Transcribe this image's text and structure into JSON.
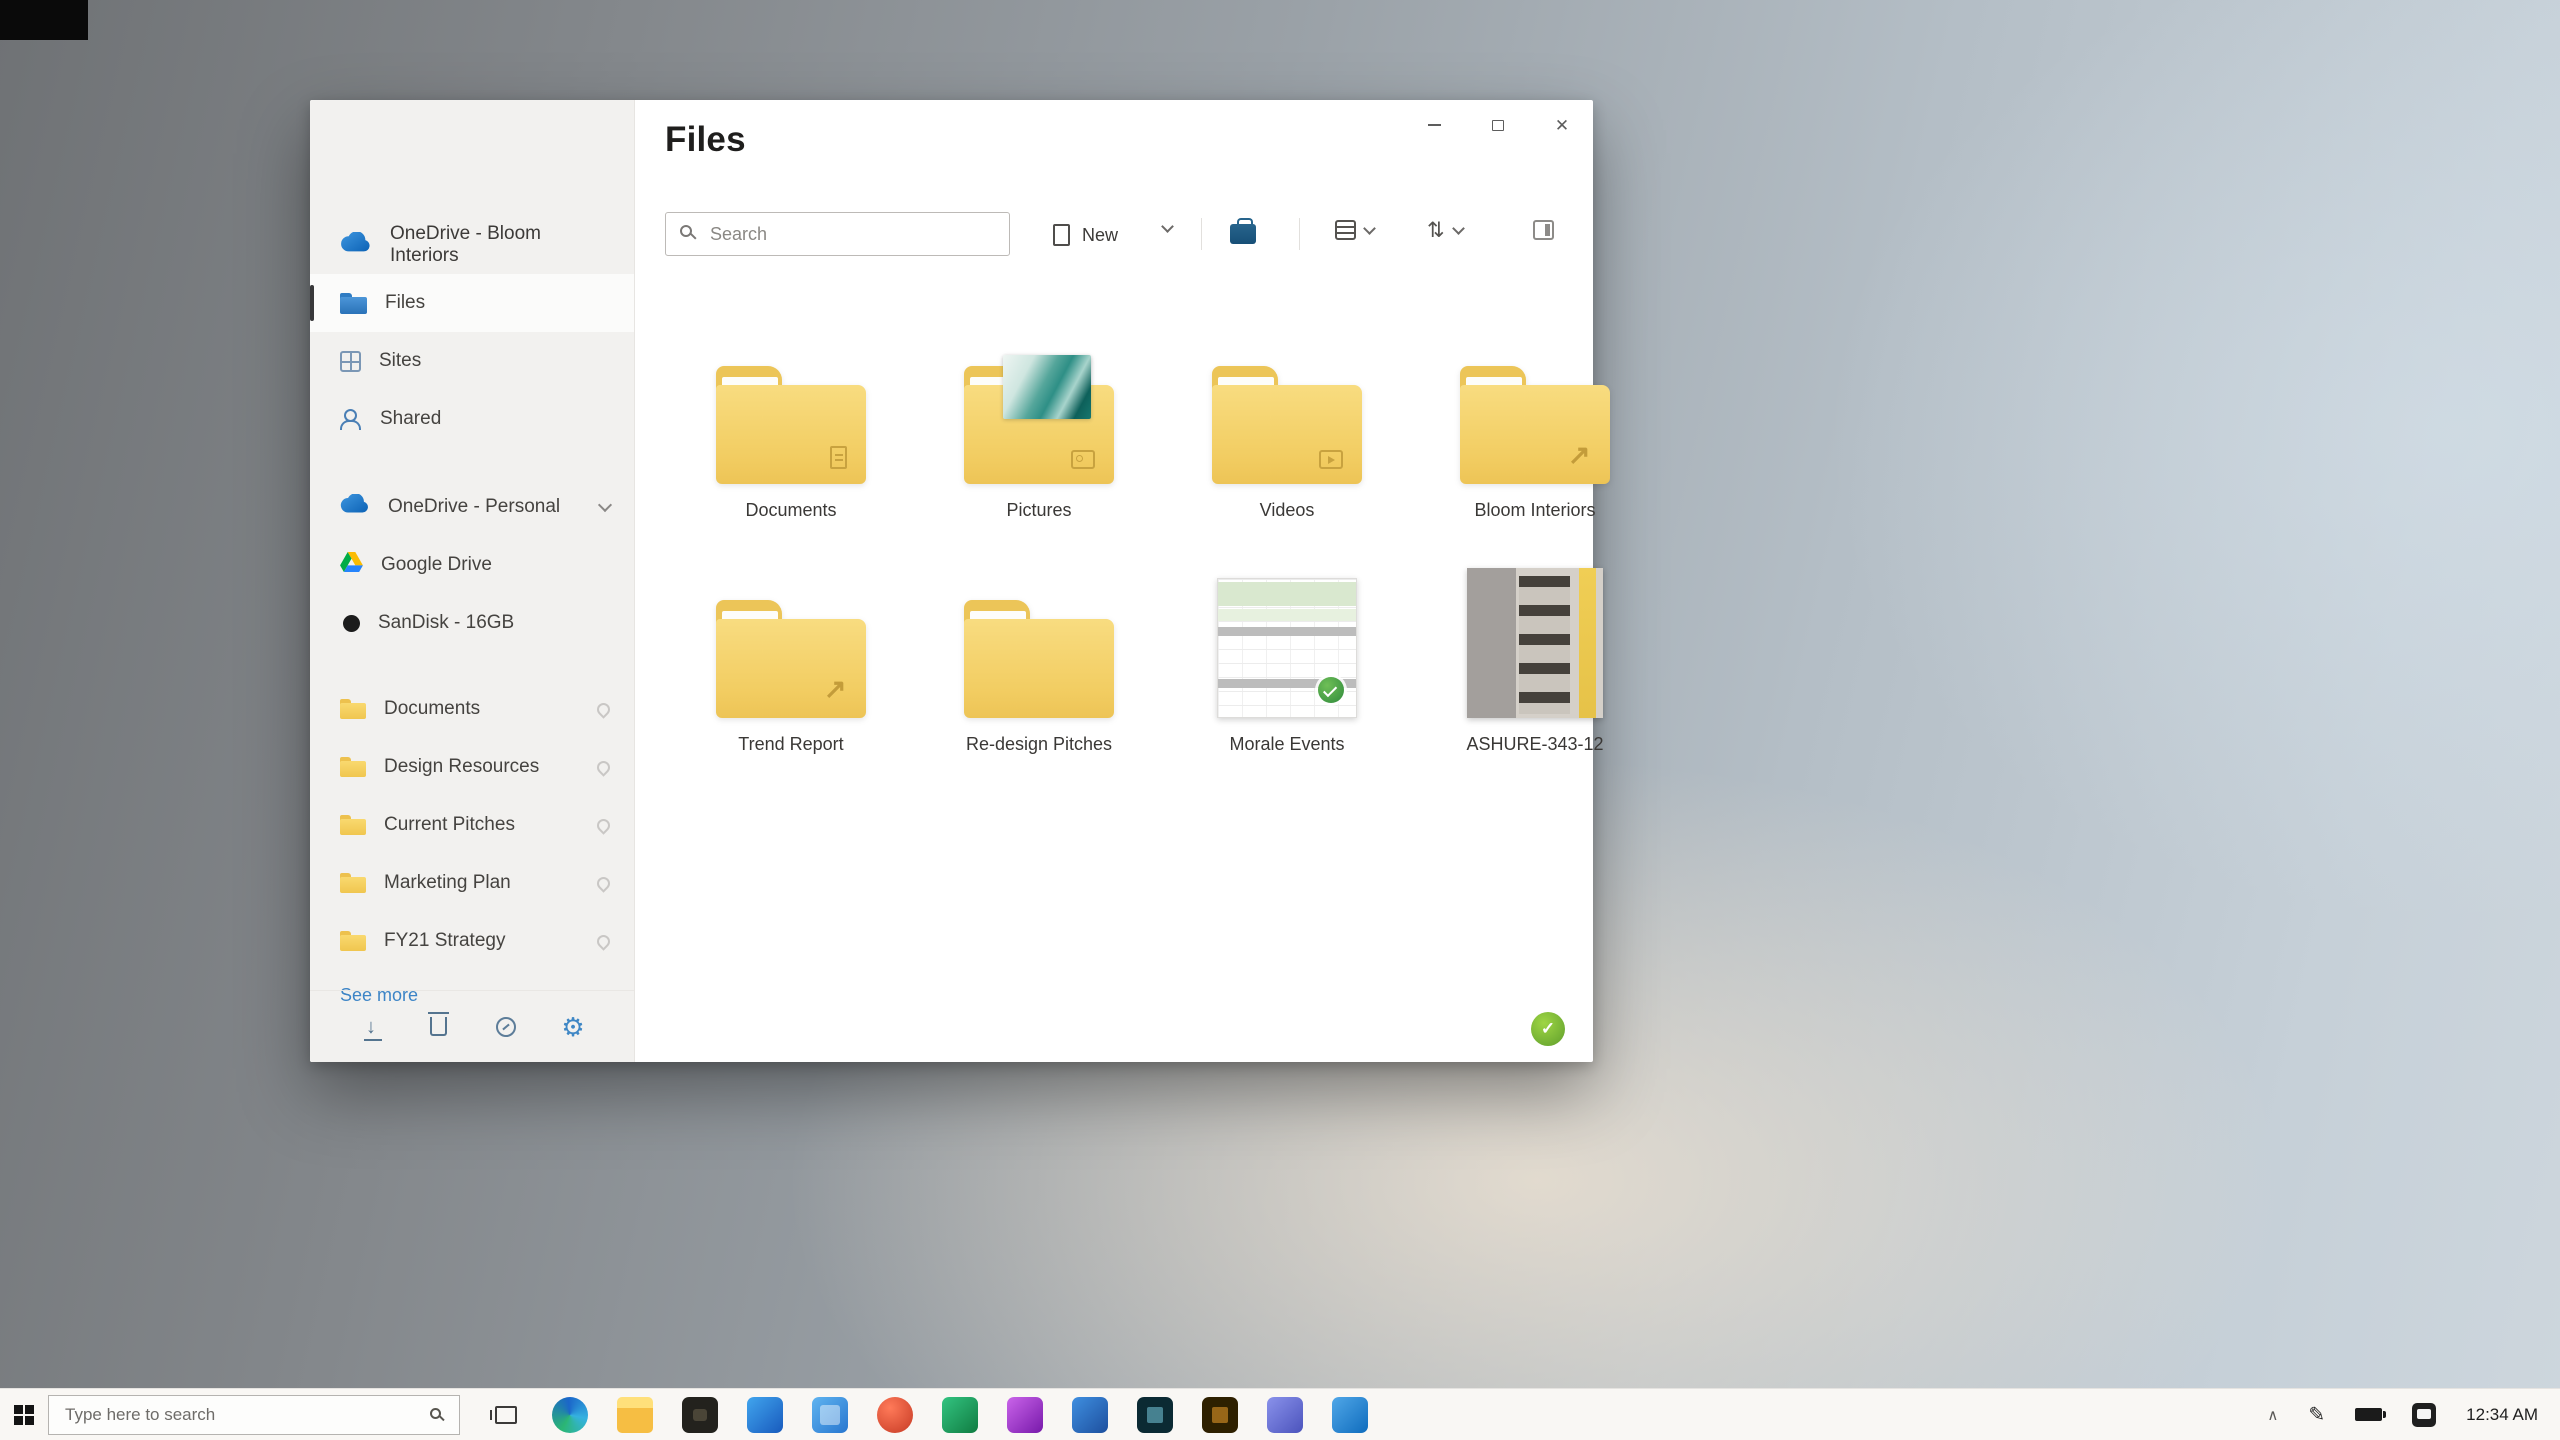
{
  "colors": {
    "accent_blue": "#2a72b8",
    "folder_yellow": "#f2cd62",
    "sync_green": "#6aa832",
    "link_blue": "#3c84c6",
    "taskbar_bg": "#f9f7f4"
  },
  "window": {
    "sidebar": {
      "account": "OneDrive - Bloom Interiors",
      "nav": [
        {
          "label": "Files"
        },
        {
          "label": "Sites"
        },
        {
          "label": "Shared"
        }
      ],
      "drives": [
        {
          "label": "OneDrive - Personal"
        },
        {
          "label": "Google Drive"
        },
        {
          "label": "SanDisk - 16GB"
        }
      ],
      "folders": [
        {
          "label": "Documents"
        },
        {
          "label": "Design Resources"
        },
        {
          "label": "Current Pitches"
        },
        {
          "label": "Marketing Plan"
        },
        {
          "label": "FY21 Strategy"
        }
      ],
      "see_more": "See more"
    },
    "main": {
      "title": "Files",
      "search_placeholder": "Search",
      "new_button": "New",
      "items": [
        {
          "label": "Documents",
          "kind": "folder"
        },
        {
          "label": "Pictures",
          "kind": "folder-with-photo"
        },
        {
          "label": "Videos",
          "kind": "folder"
        },
        {
          "label": "Bloom Interiors",
          "kind": "folder-shortcut"
        },
        {
          "label": "Trend Report",
          "kind": "folder-shortcut"
        },
        {
          "label": "Re-design Pitches",
          "kind": "folder"
        },
        {
          "label": "Morale Events",
          "kind": "excel-spreadsheet"
        },
        {
          "label": "ASHURE-343-12",
          "kind": "photo"
        }
      ]
    }
  },
  "taskbar": {
    "search_placeholder": "Type here to search",
    "clock": "12:34 AM",
    "apps": [
      {
        "name": "edge"
      },
      {
        "name": "file-explorer"
      },
      {
        "name": "camera"
      },
      {
        "name": "word"
      },
      {
        "name": "photos"
      },
      {
        "name": "opera"
      },
      {
        "name": "excel"
      },
      {
        "name": "onenote"
      },
      {
        "name": "photoshop"
      },
      {
        "name": "after-effects"
      },
      {
        "name": "illustrator"
      },
      {
        "name": "teams"
      },
      {
        "name": "outlook"
      }
    ]
  }
}
